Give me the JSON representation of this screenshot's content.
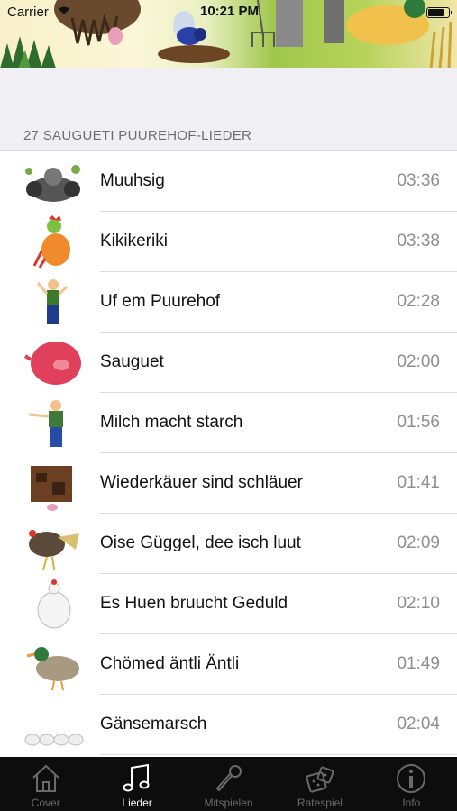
{
  "status_bar": {
    "carrier": "Carrier",
    "time": "10:21 PM"
  },
  "section_header": "27 SAUGUETI PUUREHOF-LIEDER",
  "songs": [
    {
      "title": "Muuhsig",
      "duration": "03:36"
    },
    {
      "title": "Kikikeriki",
      "duration": "03:38"
    },
    {
      "title": "Uf em Puurehof",
      "duration": "02:28"
    },
    {
      "title": "Sauguet",
      "duration": "02:00"
    },
    {
      "title": "Milch macht starch",
      "duration": "01:56"
    },
    {
      "title": "Wiederkäuer sind schläuer",
      "duration": "01:41"
    },
    {
      "title": "Oise Güggel, dee isch luut",
      "duration": "02:09"
    },
    {
      "title": "Es Huen bruucht Geduld",
      "duration": "02:10"
    },
    {
      "title": "Chömed äntli Äntli",
      "duration": "01:49"
    },
    {
      "title": "Gänsemarsch",
      "duration": "02:04"
    }
  ],
  "tabs": [
    {
      "label": "Cover",
      "icon": "house-icon"
    },
    {
      "label": "Lieder",
      "icon": "music-note-icon"
    },
    {
      "label": "Mitspielen",
      "icon": "microphone-icon"
    },
    {
      "label": "Ratespiel",
      "icon": "dice-icon"
    },
    {
      "label": "Info",
      "icon": "info-icon"
    }
  ],
  "active_tab": "Lieder"
}
